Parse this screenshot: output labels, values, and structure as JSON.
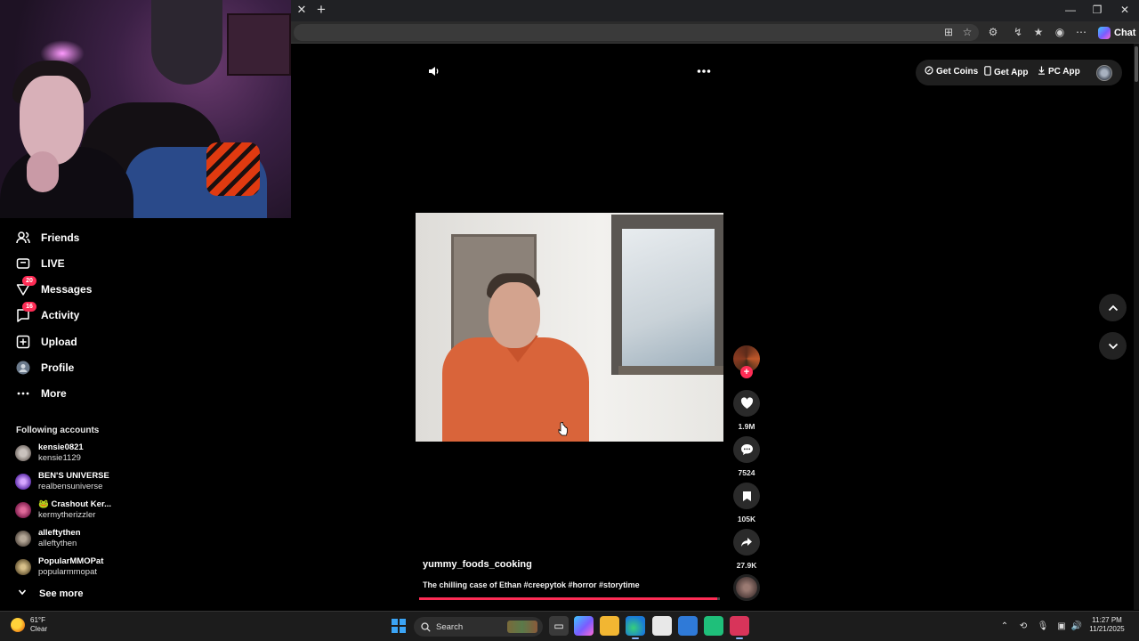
{
  "browser": {
    "copilot_label": "Chat"
  },
  "sidebar": {
    "items": [
      {
        "label": "Friends",
        "icon": "friends-icon"
      },
      {
        "label": "LIVE",
        "icon": "live-icon"
      },
      {
        "label": "Messages",
        "icon": "messages-icon",
        "badge": "20"
      },
      {
        "label": "Activity",
        "icon": "activity-icon",
        "badge": "16"
      },
      {
        "label": "Upload",
        "icon": "upload-icon"
      },
      {
        "label": "Profile",
        "icon": "profile-icon"
      },
      {
        "label": "More",
        "icon": "more-icon"
      }
    ],
    "following_header": "Following accounts",
    "accounts": [
      {
        "name": "kensie0821",
        "username": "kensie1129"
      },
      {
        "name": "BEN'S UNIVERSE",
        "username": "realbensuniverse"
      },
      {
        "name": "🐸 Crashout Ker...",
        "username": "kermytherizzler"
      },
      {
        "name": "alleftythen",
        "username": "alleftythen"
      },
      {
        "name": "PopularMMOPat",
        "username": "popularmmopat"
      }
    ],
    "see_more": "See more"
  },
  "topbar": {
    "get_coins": "Get Coins",
    "get_app": "Get App",
    "pc_app": "PC App"
  },
  "video": {
    "author": "yummy_foods_cooking",
    "caption": "The chilling case of Ethan #creepytok #horror #storytime",
    "progress": 0.99,
    "likes": "1.9M",
    "comments": "7524",
    "saves": "105K",
    "shares": "27.9K"
  },
  "taskbar": {
    "temperature": "61°F",
    "condition": "Clear",
    "search_placeholder": "Search",
    "time": "11:27 PM",
    "date": "11/21/2025"
  },
  "colors": {
    "accent": "#fe2c55",
    "background": "#000000",
    "pill": "#1f1f1f"
  }
}
